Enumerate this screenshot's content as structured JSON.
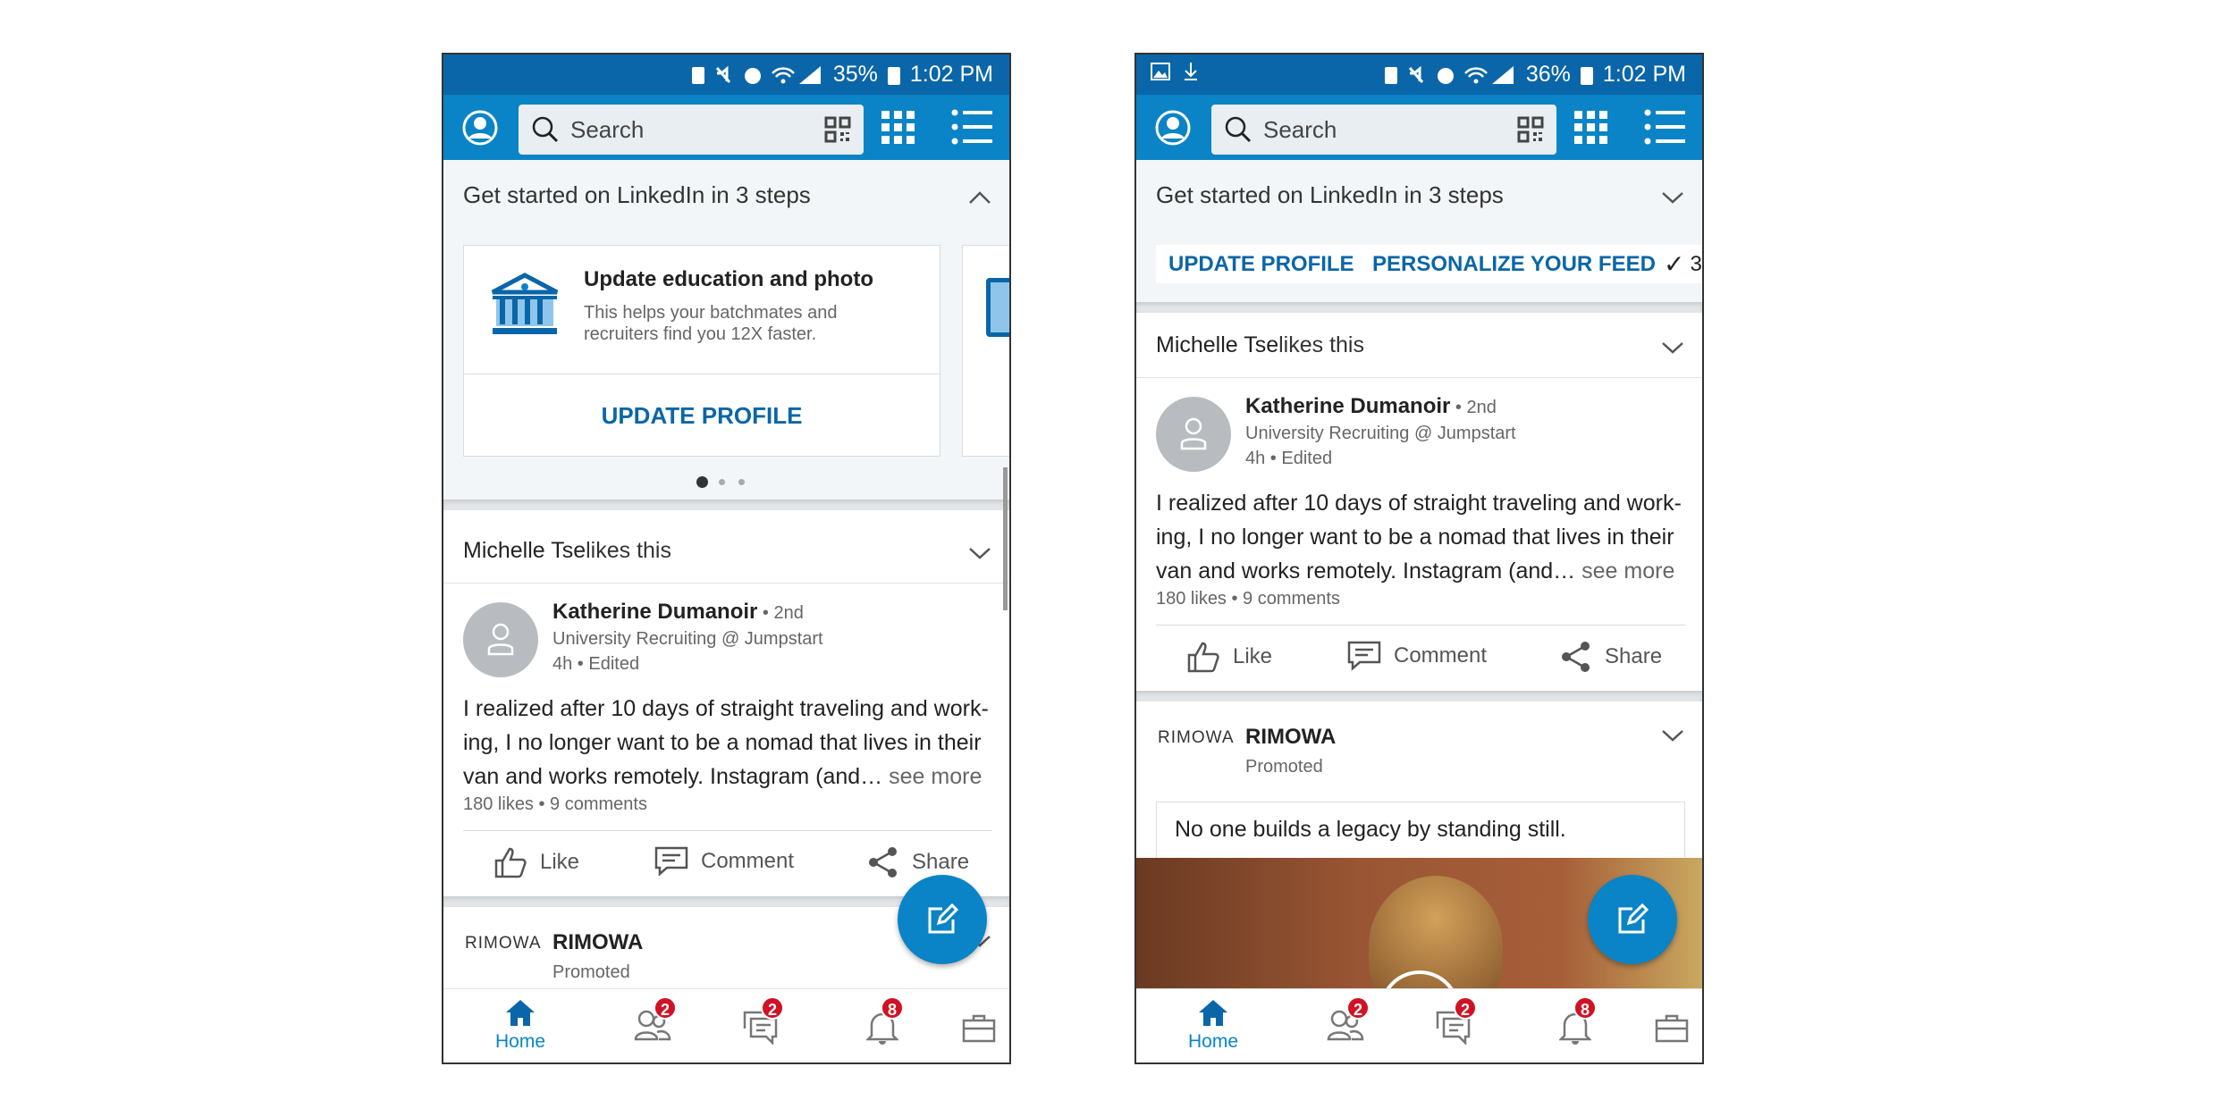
{
  "colors": {
    "brand": "#0a84c6",
    "status_bar": "#0a66a8",
    "badge": "#d11124",
    "section_bg": "#f3f6f8"
  },
  "phones": [
    {
      "status": {
        "left_icons": [],
        "icons": [
          "battery-saver-icon",
          "mute-icon",
          "alarm-icon",
          "wifi-icon",
          "signal-icon"
        ],
        "battery": "35%",
        "time": "1:02 PM"
      },
      "search": {
        "placeholder": "Search"
      },
      "onboarding": {
        "title": "Get started on LinkedIn in 3 steps",
        "expanded": true,
        "card": {
          "title": "Update education and photo",
          "desc1": "This helps your batchmates and",
          "desc2": "recruiters find you 12X faster.",
          "button": "UPDATE PROFILE"
        },
        "pager": {
          "count": 3,
          "active": 1
        }
      },
      "post": {
        "context": "Michelle Tse",
        "context_suffix": " likes this",
        "author": "Katherine Dumanoir",
        "degree": " • 2nd",
        "headline": "University Recruiting @ Jumpstart",
        "time": "4h • Edited",
        "lines": [
          "I realized after 10 days of straight traveling and work-",
          "ing, I no longer want to be a nomad that lives in their",
          "van and works remotely. Instagram (and…"
        ],
        "see_more": " see more",
        "stats": "180 likes • 9 comments",
        "actions": {
          "like": "Like",
          "comment": "Comment",
          "share": "Share"
        }
      },
      "ad": {
        "logo": "RIMOWA",
        "name": "RIMOWA",
        "label": "Promoted"
      },
      "nav": {
        "home": "Home",
        "network_badge": "2",
        "messages_badge": "2",
        "notifications_badge": "8"
      }
    },
    {
      "status": {
        "left_icons": [
          "image-icon",
          "download-icon"
        ],
        "icons": [
          "battery-saver-icon",
          "mute-icon",
          "alarm-icon",
          "wifi-icon",
          "signal-icon"
        ],
        "battery": "36%",
        "time": "1:02 PM"
      },
      "search": {
        "placeholder": "Search"
      },
      "onboarding": {
        "title": "Get started on LinkedIn in 3 steps",
        "expanded": false,
        "chips": [
          "UPDATE PROFILE",
          "PERSONALIZE YOUR FEED",
          "3"
        ]
      },
      "post": {
        "context": "Michelle Tse",
        "context_suffix": " likes this",
        "author": "Katherine Dumanoir",
        "degree": " • 2nd",
        "headline": "University Recruiting @ Jumpstart",
        "time": "4h • Edited",
        "lines": [
          "I realized after 10 days of straight traveling and work-",
          "ing, I no longer want to be a nomad that lives in their",
          "van and works remotely. Instagram (and…"
        ],
        "see_more": " see more",
        "stats": "180 likes • 9 comments",
        "actions": {
          "like": "Like",
          "comment": "Comment",
          "share": "Share"
        }
      },
      "ad": {
        "logo": "RIMOWA",
        "name": "RIMOWA",
        "label": "Promoted",
        "headline": "No one builds a legacy by standing still."
      },
      "nav": {
        "home": "Home",
        "network_badge": "2",
        "messages_badge": "2",
        "notifications_badge": "8"
      }
    }
  ]
}
